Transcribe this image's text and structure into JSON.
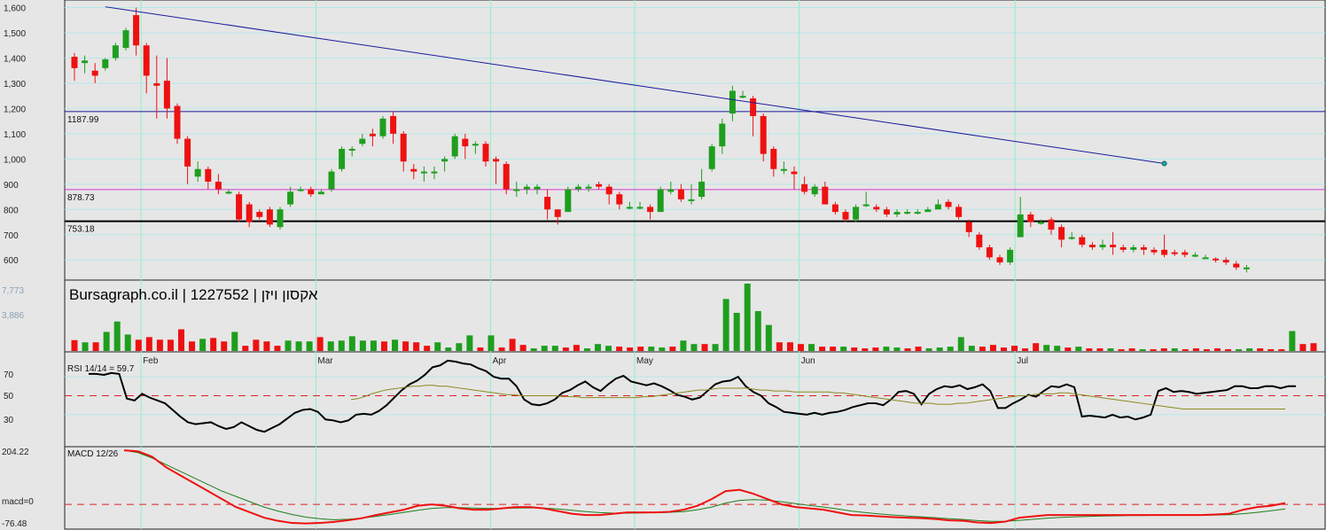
{
  "chart_data": {
    "type": "candlestick",
    "watermark": "Bursagraph.co.il | 1227552 | אקסון ויזן",
    "price_axis": {
      "ticks": [
        600,
        700,
        800,
        900,
        1000,
        1100,
        1200,
        1300,
        1400,
        1500,
        1600
      ],
      "tick_labels": [
        "600",
        "700",
        "800",
        "900",
        "1,000",
        "1,100",
        "1,200",
        "1,300",
        "1,400",
        "1,500",
        "1,600"
      ],
      "ylim": [
        520,
        1630
      ]
    },
    "levels": [
      {
        "value": 1187.99,
        "label": "1187.99",
        "color": "#1a1a9c"
      },
      {
        "value": 878.73,
        "label": "878.73",
        "color": "#d23ad2"
      },
      {
        "value": 753.18,
        "label": "753.18",
        "color": "#000000"
      }
    ],
    "trendline": {
      "from": [
        3,
        1603
      ],
      "to": [
        106,
        982
      ],
      "color": "#1a1a9c"
    },
    "months": [
      {
        "label": "Feb",
        "index": 7
      },
      {
        "label": "Mar",
        "index": 24
      },
      {
        "label": "Apr",
        "index": 41
      },
      {
        "label": "May",
        "index": 55
      },
      {
        "label": "Jun",
        "index": 71
      },
      {
        "label": "Jul",
        "index": 92
      }
    ],
    "candles": [
      [
        1405,
        1360,
        1310,
        1420
      ],
      [
        1380,
        1390,
        1340,
        1410
      ],
      [
        1350,
        1330,
        1300,
        1380
      ],
      [
        1360,
        1395,
        1350,
        1400
      ],
      [
        1400,
        1450,
        1390,
        1460
      ],
      [
        1440,
        1510,
        1430,
        1520
      ],
      [
        1570,
        1450,
        1410,
        1600
      ],
      [
        1450,
        1330,
        1260,
        1460
      ],
      [
        1300,
        1290,
        1160,
        1410
      ],
      [
        1310,
        1200,
        1160,
        1400
      ],
      [
        1210,
        1080,
        1060,
        1220
      ],
      [
        1080,
        970,
        900,
        1090
      ],
      [
        930,
        960,
        910,
        990
      ],
      [
        960,
        910,
        880,
        970
      ],
      [
        910,
        880,
        860,
        940
      ],
      [
        870,
        870,
        860,
        880
      ],
      [
        860,
        760,
        750,
        870
      ],
      [
        820,
        750,
        730,
        830
      ],
      [
        790,
        770,
        760,
        800
      ],
      [
        800,
        740,
        730,
        810
      ],
      [
        730,
        800,
        720,
        810
      ],
      [
        820,
        870,
        810,
        890
      ],
      [
        880,
        880,
        870,
        890
      ],
      [
        880,
        860,
        850,
        890
      ],
      [
        860,
        870,
        860,
        880
      ],
      [
        880,
        950,
        870,
        960
      ],
      [
        960,
        1040,
        950,
        1050
      ],
      [
        1040,
        1040,
        1010,
        1050
      ],
      [
        1060,
        1080,
        1050,
        1100
      ],
      [
        1100,
        1090,
        1050,
        1120
      ],
      [
        1090,
        1160,
        1080,
        1170
      ],
      [
        1170,
        1100,
        1060,
        1190
      ],
      [
        1100,
        990,
        950,
        1110
      ],
      [
        960,
        950,
        920,
        980
      ],
      [
        950,
        950,
        910,
        970
      ],
      [
        950,
        950,
        920,
        970
      ],
      [
        990,
        1000,
        950,
        1010
      ],
      [
        1010,
        1090,
        1000,
        1100
      ],
      [
        1080,
        1050,
        1000,
        1100
      ],
      [
        1060,
        1060,
        1020,
        1070
      ],
      [
        1060,
        990,
        970,
        1070
      ],
      [
        1000,
        990,
        900,
        1010
      ],
      [
        980,
        880,
        860,
        990
      ],
      [
        880,
        880,
        850,
        910
      ],
      [
        880,
        890,
        860,
        900
      ],
      [
        880,
        890,
        860,
        900
      ],
      [
        850,
        800,
        760,
        880
      ],
      [
        800,
        770,
        740,
        800
      ],
      [
        790,
        880,
        860,
        890
      ],
      [
        880,
        890,
        870,
        900
      ],
      [
        890,
        890,
        870,
        900
      ],
      [
        900,
        890,
        880,
        910
      ],
      [
        890,
        860,
        820,
        900
      ],
      [
        860,
        820,
        800,
        870
      ],
      [
        810,
        810,
        800,
        830
      ],
      [
        810,
        810,
        800,
        830
      ],
      [
        810,
        790,
        760,
        820
      ],
      [
        790,
        880,
        790,
        890
      ],
      [
        870,
        880,
        860,
        910
      ],
      [
        880,
        840,
        830,
        900
      ],
      [
        840,
        840,
        820,
        900
      ],
      [
        850,
        910,
        840,
        960
      ],
      [
        960,
        1050,
        950,
        1060
      ],
      [
        1050,
        1140,
        1020,
        1160
      ],
      [
        1180,
        1270,
        1150,
        1290
      ],
      [
        1250,
        1250,
        1240,
        1270
      ],
      [
        1240,
        1170,
        1090,
        1250
      ],
      [
        1170,
        1020,
        990,
        1180
      ],
      [
        1040,
        960,
        930,
        1050
      ],
      [
        960,
        960,
        940,
        990
      ],
      [
        950,
        940,
        880,
        970
      ],
      [
        900,
        870,
        860,
        930
      ],
      [
        860,
        890,
        850,
        900
      ],
      [
        890,
        820,
        820,
        910
      ],
      [
        820,
        790,
        780,
        830
      ],
      [
        790,
        760,
        750,
        800
      ],
      [
        760,
        810,
        750,
        820
      ],
      [
        820,
        820,
        810,
        870
      ],
      [
        810,
        800,
        790,
        820
      ],
      [
        800,
        780,
        770,
        810
      ],
      [
        780,
        790,
        770,
        800
      ],
      [
        790,
        790,
        780,
        800
      ],
      [
        790,
        790,
        780,
        800
      ],
      [
        790,
        800,
        790,
        810
      ],
      [
        800,
        820,
        800,
        840
      ],
      [
        830,
        810,
        800,
        840
      ],
      [
        810,
        770,
        760,
        820
      ],
      [
        750,
        710,
        690,
        760
      ],
      [
        700,
        650,
        640,
        710
      ],
      [
        650,
        610,
        600,
        660
      ],
      [
        610,
        590,
        580,
        620
      ],
      [
        590,
        640,
        580,
        650
      ],
      [
        690,
        780,
        700,
        850
      ],
      [
        780,
        750,
        730,
        790
      ],
      [
        750,
        750,
        740,
        760
      ],
      [
        760,
        720,
        700,
        770
      ],
      [
        730,
        680,
        650,
        740
      ],
      [
        690,
        690,
        680,
        710
      ],
      [
        690,
        660,
        650,
        700
      ],
      [
        660,
        650,
        640,
        670
      ],
      [
        650,
        660,
        640,
        680
      ],
      [
        660,
        650,
        620,
        710
      ],
      [
        650,
        640,
        630,
        660
      ],
      [
        640,
        650,
        630,
        660
      ],
      [
        650,
        640,
        620,
        660
      ],
      [
        640,
        630,
        620,
        650
      ],
      [
        640,
        620,
        610,
        700
      ],
      [
        630,
        625,
        615,
        640
      ],
      [
        630,
        620,
        610,
        640
      ],
      [
        620,
        620,
        610,
        630
      ],
      [
        610,
        610,
        610,
        620
      ],
      [
        605,
        600,
        590,
        610
      ],
      [
        600,
        590,
        580,
        610
      ],
      [
        585,
        570,
        560,
        595
      ],
      [
        570,
        570,
        550,
        580
      ]
    ],
    "volume": {
      "axis_labels": [
        "7,773",
        "3,886"
      ],
      "max": 7773,
      "values": [
        1250,
        1000,
        1000,
        2200,
        3400,
        1900,
        1300,
        1600,
        1300,
        1300,
        2500,
        1100,
        1400,
        1500,
        1100,
        2200,
        600,
        1300,
        1100,
        600,
        1200,
        1100,
        1100,
        1600,
        1100,
        1200,
        1700,
        1200,
        1200,
        1100,
        1300,
        1100,
        1000,
        600,
        1000,
        400,
        900,
        1800,
        400,
        1800,
        400,
        1400,
        700,
        300,
        600,
        600,
        400,
        700,
        300,
        800,
        600,
        500,
        400,
        500,
        500,
        400,
        500,
        1200,
        800,
        800,
        800,
        6000,
        4400,
        7773,
        4600,
        3000,
        1000,
        1000,
        800,
        800,
        500,
        500,
        500,
        400,
        300,
        400,
        500,
        400,
        300,
        500,
        300,
        400,
        500,
        1600,
        600,
        500,
        700,
        400,
        600,
        300,
        900,
        700,
        600,
        400,
        500,
        300,
        300,
        300,
        200,
        300,
        200,
        200,
        300,
        300,
        200,
        300,
        200,
        300,
        200,
        200,
        300,
        300,
        200,
        200,
        2300,
        800,
        900
      ]
    },
    "rsi": {
      "label": "RSI 14/14 = 59.7",
      "ticks": [
        "70",
        "50",
        "30"
      ],
      "signal_level": 50,
      "values": [
        73,
        73,
        72,
        74,
        73,
        47,
        45,
        52,
        48,
        45,
        42,
        35,
        28,
        22,
        20,
        21,
        22,
        18,
        15,
        17,
        22,
        18,
        14,
        12,
        16,
        20,
        26,
        32,
        35,
        36,
        33,
        25,
        24,
        22,
        24,
        30,
        31,
        30,
        34,
        40,
        48,
        56,
        62,
        66,
        72,
        80,
        82,
        87,
        86,
        84,
        83,
        79,
        76,
        70,
        68,
        68,
        60,
        46,
        41,
        40,
        42,
        46,
        53,
        56,
        61,
        65,
        59,
        55,
        62,
        68,
        71,
        65,
        63,
        61,
        63,
        60,
        56,
        51,
        49,
        46,
        48,
        55,
        62,
        65,
        66,
        70,
        60,
        54,
        50,
        42,
        38,
        33,
        32,
        31,
        30,
        32,
        30,
        32,
        33,
        35,
        38,
        40,
        42,
        42,
        40,
        46,
        54,
        55,
        52,
        41,
        52,
        57,
        60,
        59,
        61,
        57,
        59,
        62,
        55,
        37,
        37,
        42,
        46,
        51,
        49,
        55,
        60,
        59,
        62,
        59,
        28,
        29,
        28,
        27,
        30,
        27,
        28,
        25,
        27,
        30,
        55,
        58,
        54,
        55,
        54,
        52,
        53,
        54,
        55,
        56,
        60,
        60,
        58,
        58,
        60,
        60,
        58,
        60,
        60
      ],
      "signal": [
        46,
        47,
        49,
        52,
        54,
        56,
        57,
        58,
        59,
        60,
        60,
        61,
        61,
        60,
        60,
        59,
        58,
        57,
        56,
        55,
        54,
        53,
        52,
        51,
        51,
        50,
        50,
        50,
        50,
        50,
        50,
        49,
        49,
        49,
        48,
        48,
        48,
        48,
        48,
        48,
        48,
        48,
        48,
        49,
        49,
        50,
        51,
        52,
        53,
        54,
        55,
        56,
        56,
        57,
        58,
        58,
        58,
        58,
        58,
        57,
        56,
        56,
        55,
        55,
        55,
        54,
        54,
        54,
        54,
        54,
        54,
        53,
        53,
        52,
        51,
        50,
        49,
        48,
        47,
        46,
        45,
        44,
        43,
        42,
        42,
        42,
        41,
        41,
        41,
        42,
        42,
        43,
        44,
        45,
        46,
        47,
        48,
        49,
        50,
        50,
        51,
        52,
        52,
        52,
        53,
        53,
        52,
        51,
        50,
        49,
        48,
        47,
        46,
        45,
        44,
        43,
        42,
        41,
        40,
        39,
        38,
        37,
        36,
        36,
        36,
        36,
        36,
        36,
        36,
        36,
        36,
        36,
        36,
        36,
        36,
        36,
        36,
        36
      ]
    },
    "macd": {
      "label": "MACD 12/26",
      "axis_labels": [
        "204.22",
        "macd=0",
        "-76.48"
      ],
      "ylim": [
        -76.48,
        204.22
      ],
      "values": [
        204,
        200,
        180,
        140,
        110,
        80,
        50,
        20,
        -10,
        -30,
        -50,
        -62,
        -70,
        -72,
        -70,
        -66,
        -60,
        -52,
        -40,
        -30,
        -20,
        -5,
        0,
        -5,
        -15,
        -20,
        -20,
        -15,
        -10,
        -10,
        -15,
        -25,
        -35,
        -40,
        -40,
        -35,
        -30,
        -30,
        -30,
        -28,
        -20,
        -5,
        20,
        50,
        55,
        40,
        20,
        0,
        -10,
        -15,
        -20,
        -30,
        -40,
        -42,
        -45,
        -48,
        -50,
        -52,
        -55,
        -60,
        -62,
        -68,
        -70,
        -65,
        -50,
        -45,
        -40,
        -40,
        -40,
        -40,
        -40,
        -40,
        -40,
        -40,
        -40,
        -40,
        -40,
        -40,
        -38,
        -35,
        -20,
        -10,
        -5,
        5
      ],
      "signal": [
        204,
        195,
        175,
        150,
        125,
        100,
        75,
        50,
        30,
        10,
        -10,
        -25,
        -38,
        -48,
        -54,
        -58,
        -56,
        -52,
        -45,
        -38,
        -30,
        -22,
        -15,
        -12,
        -12,
        -14,
        -15,
        -15,
        -14,
        -13,
        -14,
        -17,
        -22,
        -27,
        -31,
        -33,
        -33,
        -32,
        -31,
        -30,
        -27,
        -20,
        -10,
        5,
        15,
        18,
        16,
        10,
        3,
        -4,
        -10,
        -17,
        -25,
        -31,
        -36,
        -40,
        -44,
        -47,
        -50,
        -54,
        -57,
        -61,
        -64,
        -64,
        -60,
        -56,
        -52,
        -49,
        -47,
        -45,
        -44,
        -43,
        -42,
        -42,
        -41,
        -41,
        -41,
        -41,
        -40,
        -39,
        -35,
        -30,
        -24,
        -17
      ]
    },
    "colors": {
      "up": "#1e9e1e",
      "down": "#ee1111",
      "grid_v": "#8ff0c8",
      "grid_h": "#b8e8e8",
      "rsi_line": "#000000",
      "rsi_signal": "#8a8a20",
      "macd_line": "#ee1111",
      "macd_signal": "#1e7e1e",
      "ref_dash": "#dd2222"
    }
  }
}
